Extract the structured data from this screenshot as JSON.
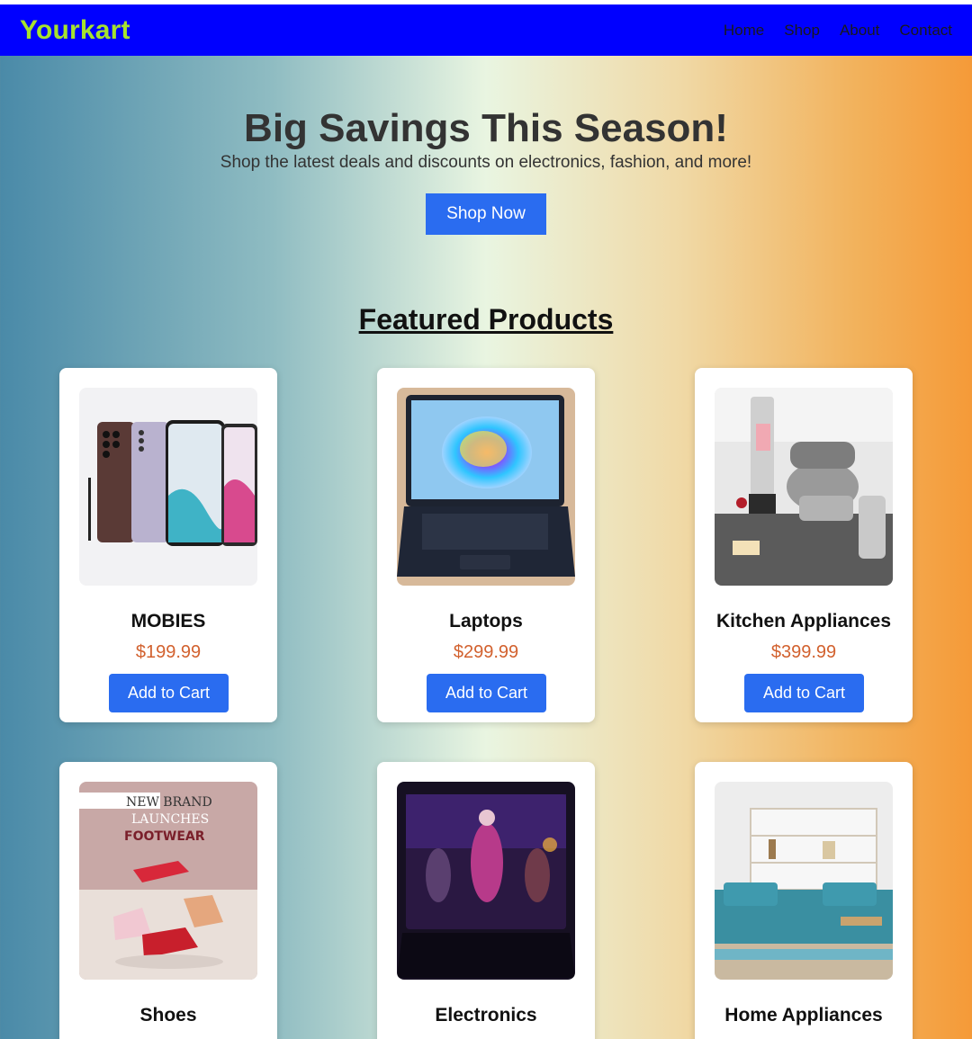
{
  "navbar": {
    "brand": "Yourkart",
    "links": [
      "Home",
      "Shop",
      "About",
      "Contact"
    ]
  },
  "hero": {
    "title": "Big Savings This Season!",
    "subtitle": "Shop the latest deals and discounts on electronics, fashion, and more!",
    "cta": "Shop Now"
  },
  "featured": {
    "title": "Featured Products",
    "cart_label": "Add to Cart",
    "products": [
      {
        "name": "MOBIES",
        "price": "$199.99"
      },
      {
        "name": "Laptops",
        "price": "$299.99"
      },
      {
        "name": "Kitchen Appliances",
        "price": "$399.99"
      },
      {
        "name": "Shoes",
        "price": ""
      },
      {
        "name": "Electronics",
        "price": ""
      },
      {
        "name": "Home Appliances",
        "price": ""
      }
    ],
    "shoes_banner": {
      "line1": "NEW BRAND",
      "line2": "LAUNCHES",
      "line3": "FOOTWEAR"
    }
  },
  "colors": {
    "navbar": "#0000ff",
    "brand": "#a6e22e",
    "button": "#2a6cf0",
    "price": "#d2612e"
  }
}
